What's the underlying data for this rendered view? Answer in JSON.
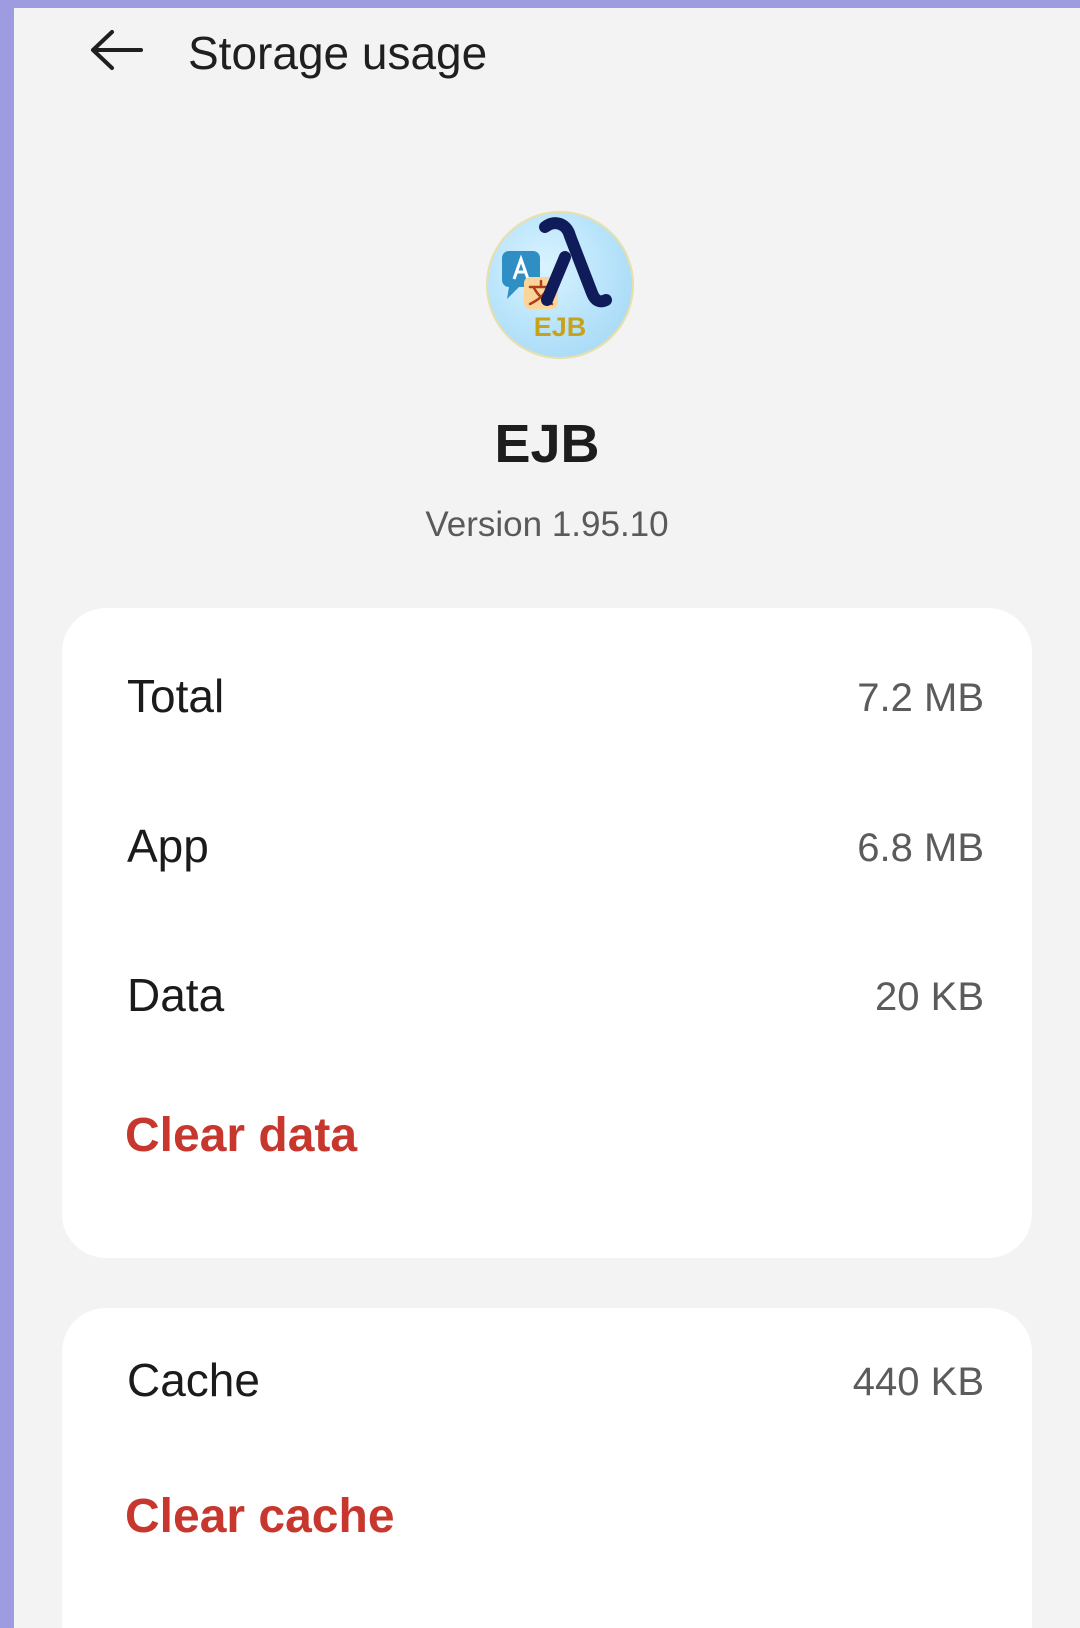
{
  "header": {
    "back_icon": "arrow-left-icon",
    "title": "Storage usage"
  },
  "app": {
    "name": "EJB",
    "version": "Version 1.95.10",
    "icon": {
      "name": "app-logo-icon",
      "badge_text": "EJB"
    }
  },
  "storage": {
    "rows": [
      {
        "label": "Total",
        "value": "7.2 MB"
      },
      {
        "label": "App",
        "value": "6.8 MB"
      },
      {
        "label": "Data",
        "value": "20 KB"
      }
    ],
    "clear_data_label": "Clear data"
  },
  "cache": {
    "label": "Cache",
    "value": "440 KB",
    "clear_cache_label": "Clear cache"
  },
  "colors": {
    "accent_red": "#c8372d",
    "background": "#f3f3f3",
    "card": "#ffffff",
    "outer_border": "#9f9be0"
  }
}
